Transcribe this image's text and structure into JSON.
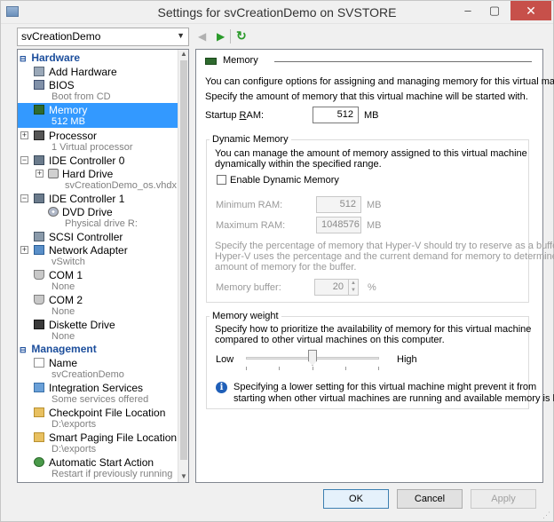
{
  "window": {
    "title": "Settings for svCreationDemo on SVSTORE",
    "minimize": "–",
    "maximize": "▢",
    "close": "✕"
  },
  "vm_select": {
    "value": "svCreationDemo"
  },
  "nav": {
    "back": "◀",
    "forward": "▶",
    "refresh": "↻"
  },
  "sections": {
    "hardware": "Hardware",
    "management": "Management"
  },
  "tree": {
    "add_hardware": {
      "label": "Add Hardware"
    },
    "bios": {
      "label": "BIOS",
      "sub": "Boot from CD"
    },
    "memory": {
      "label": "Memory",
      "sub": "512 MB"
    },
    "processor": {
      "label": "Processor",
      "sub": "1 Virtual processor"
    },
    "ide0": {
      "label": "IDE Controller 0"
    },
    "hard_drive": {
      "label": "Hard Drive",
      "sub": "svCreationDemo_os.vhdx"
    },
    "ide1": {
      "label": "IDE Controller 1"
    },
    "dvd": {
      "label": "DVD Drive",
      "sub": "Physical drive R:"
    },
    "scsi": {
      "label": "SCSI Controller"
    },
    "net": {
      "label": "Network Adapter",
      "sub": "vSwitch"
    },
    "com1": {
      "label": "COM 1",
      "sub": "None"
    },
    "com2": {
      "label": "COM 2",
      "sub": "None"
    },
    "diskette": {
      "label": "Diskette Drive",
      "sub": "None"
    },
    "name": {
      "label": "Name",
      "sub": "svCreationDemo"
    },
    "integration": {
      "label": "Integration Services",
      "sub": "Some services offered"
    },
    "checkpoint": {
      "label": "Checkpoint File Location",
      "sub": "D:\\exports"
    },
    "paging": {
      "label": "Smart Paging File Location",
      "sub": "D:\\exports"
    },
    "autostart": {
      "label": "Automatic Start Action",
      "sub": "Restart if previously running"
    }
  },
  "memory": {
    "heading": "Memory",
    "desc1": "You can configure options for assigning and managing memory for this virtual machine.",
    "desc2": "Specify the amount of memory that this virtual machine will be started with.",
    "startup_label_prefix": "Startup ",
    "startup_label_key": "R",
    "startup_label_suffix": "AM:",
    "startup_value": "512",
    "startup_unit": "MB",
    "dynamic": {
      "title": "Dynamic Memory",
      "desc1": "You can manage the amount of memory assigned to this virtual machine",
      "desc2": "dynamically within the specified range.",
      "enable_label": "Enable Dynamic Memory",
      "enabled": false,
      "min_label": "Minimum RAM:",
      "min_value": "512",
      "min_unit": "MB",
      "max_label": "Maximum RAM:",
      "max_value": "1048576",
      "max_unit": "MB",
      "buffer_desc1": "Specify the percentage of memory that Hyper-V should try to reserve as a buffer.",
      "buffer_desc2": "Hyper-V uses the percentage and the current demand for memory to determine an",
      "buffer_desc3": "amount of memory for the buffer.",
      "buffer_label": "Memory buffer:",
      "buffer_value": "20",
      "buffer_unit": "%"
    },
    "weight": {
      "title": "Memory weight",
      "desc1": "Specify how to prioritize the availability of memory for this virtual machine",
      "desc2": "compared to other virtual machines on this computer.",
      "low": "Low",
      "high": "High",
      "slider_value": 0.5,
      "info1": "Specifying a lower setting for this virtual machine might prevent it from",
      "info2": "starting when other virtual machines are running and available memory is low."
    }
  },
  "buttons": {
    "ok": "OK",
    "cancel": "Cancel",
    "apply": "Apply"
  }
}
